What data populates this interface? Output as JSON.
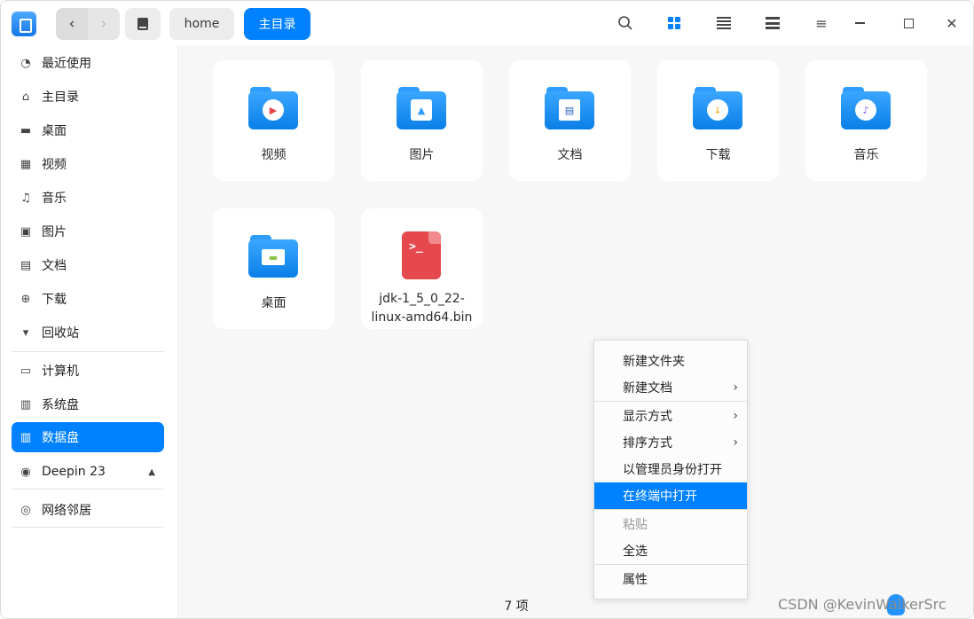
{
  "titlebar": {
    "breadcrumb": [
      "home",
      "主目录"
    ],
    "icons": [
      "app-logo-icon",
      "back-icon",
      "forward-icon",
      "disk-icon",
      "search-icon",
      "icon-view-icon",
      "list-view-icon",
      "detail-view-icon",
      "menu-icon",
      "minimize-icon",
      "maximize-icon",
      "close-icon"
    ],
    "accent_color": "#0081ff"
  },
  "sidebar": {
    "items": [
      {
        "label": "最近使用",
        "icon": "clock-icon"
      },
      {
        "label": "主目录",
        "icon": "home-icon"
      },
      {
        "label": "桌面",
        "icon": "desktop-icon"
      },
      {
        "label": "视频",
        "icon": "video-icon"
      },
      {
        "label": "音乐",
        "icon": "music-icon"
      },
      {
        "label": "图片",
        "icon": "picture-icon"
      },
      {
        "label": "文档",
        "icon": "document-icon"
      },
      {
        "label": "下载",
        "icon": "download-icon"
      },
      {
        "label": "回收站",
        "icon": "trash-icon"
      }
    ],
    "devices": [
      {
        "label": "计算机",
        "icon": "computer-icon"
      },
      {
        "label": "系统盘",
        "icon": "disk-icon"
      },
      {
        "label": "数据盘",
        "icon": "disk-icon",
        "active": true
      },
      {
        "label": "Deepin 23",
        "icon": "optical-disc-icon"
      }
    ],
    "network": [
      {
        "label": "网络邻居",
        "icon": "network-icon"
      }
    ]
  },
  "files": [
    {
      "name": "视频",
      "type": "folder",
      "badge": "video-icon"
    },
    {
      "name": "图片",
      "type": "folder",
      "badge": "picture-icon"
    },
    {
      "name": "文档",
      "type": "folder",
      "badge": "document-icon"
    },
    {
      "name": "下载",
      "type": "folder",
      "badge": "download-icon"
    },
    {
      "name": "音乐",
      "type": "folder",
      "badge": "music-icon"
    },
    {
      "name": "桌面",
      "type": "folder",
      "badge": "desktop-icon"
    },
    {
      "name_line1": "jdk-1_5_0_22-",
      "name_line2": "linux-amd64.bin",
      "type": "executable",
      "prompt": ">_"
    }
  ],
  "status": {
    "count_text": "7 项"
  },
  "context_menu": {
    "items": [
      {
        "label": "新建文件夹"
      },
      {
        "label": "新建文档",
        "submenu": true
      },
      {
        "label": "显示方式",
        "submenu": true
      },
      {
        "label": "排序方式",
        "submenu": true
      },
      {
        "label": "以管理员身份打开"
      },
      {
        "label": "在终端中打开",
        "highlighted": true
      },
      {
        "label": "粘贴",
        "disabled": true
      },
      {
        "label": "全选"
      },
      {
        "label": "属性"
      }
    ],
    "arrow": "›"
  },
  "watermark": {
    "text": "CSDN @KevinWalkerSrc"
  }
}
